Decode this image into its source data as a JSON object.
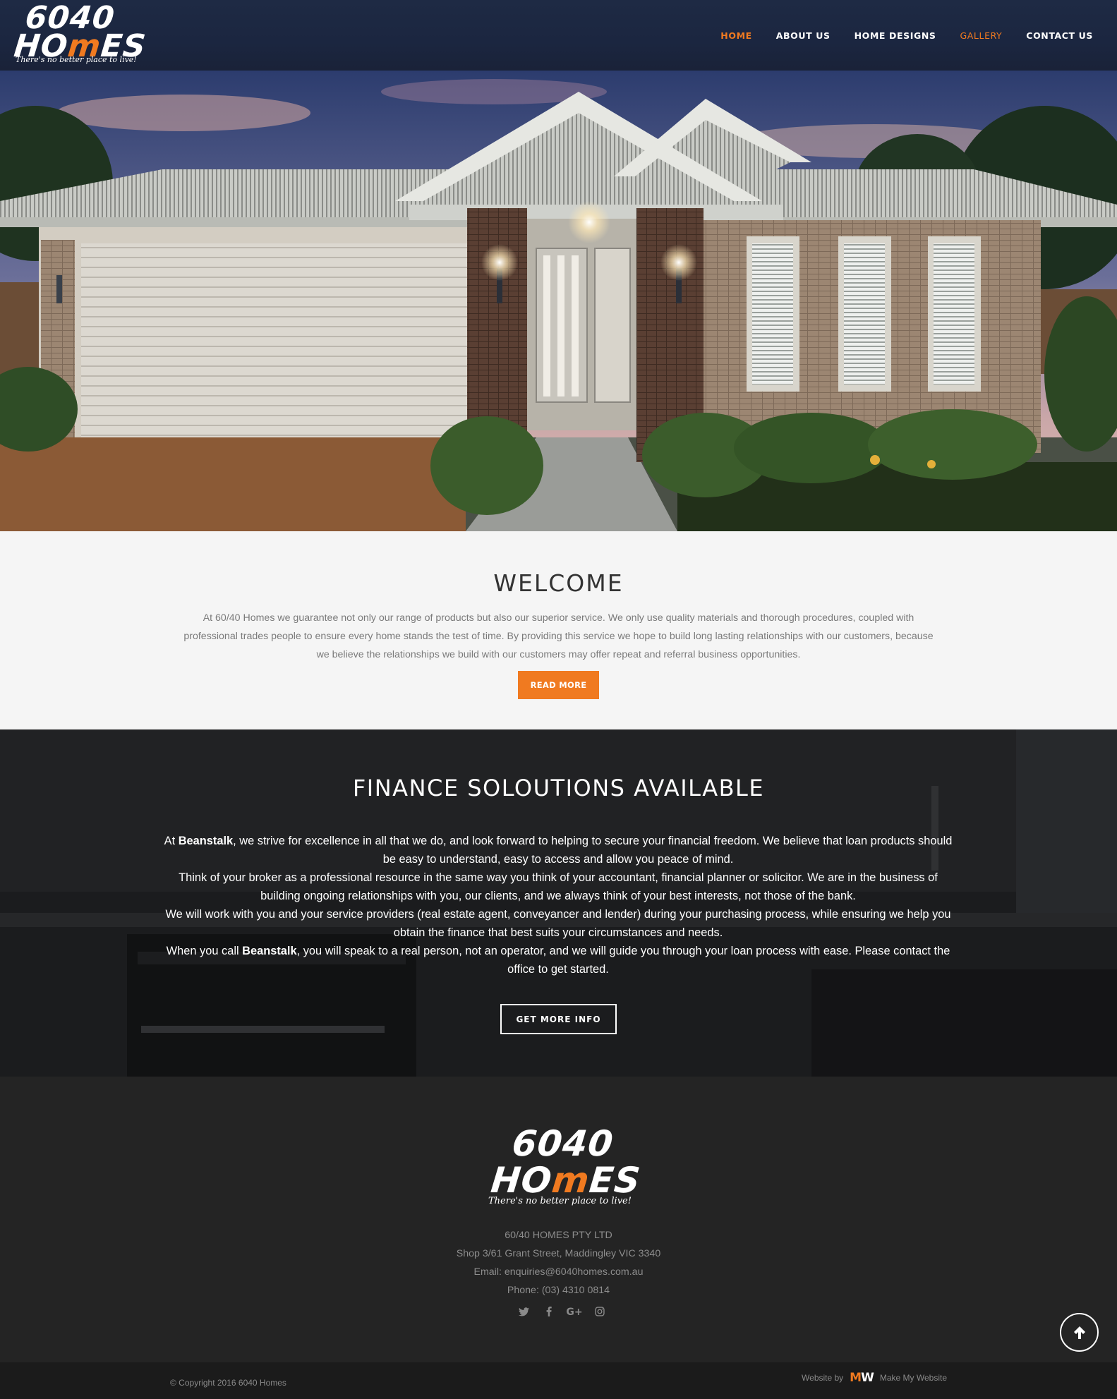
{
  "brand": {
    "logo_line1": "6040",
    "logo_line2_a": "HO",
    "logo_line2_m": "m",
    "logo_line2_b": "ES",
    "tagline": "There's no better place to live!",
    "accent_color": "#f07a20"
  },
  "nav": {
    "items": [
      {
        "label": "HOME",
        "active": true
      },
      {
        "label": "ABOUT US",
        "active": false
      },
      {
        "label": "HOME DESIGNS",
        "active": false
      },
      {
        "label": "GALLERY",
        "active": false
      },
      {
        "label": "CONTACT US",
        "active": false
      }
    ]
  },
  "welcome": {
    "title": "WELCOME",
    "text": "At 60/40 Homes we guarantee not only our range of products but also our superior service. We only use quality materials and thorough procedures, coupled with professional trades people to ensure every home stands the test of time. By providing this service we hope to build long lasting relationships with our customers, because we believe the relationships we build with our customers may offer repeat and referral business opportunities.",
    "button": "READ MORE"
  },
  "finance": {
    "title": "FINANCE SOLOUTIONS AVAILABLE",
    "p1_a": "At ",
    "p1_bold": "Beanstalk",
    "p1_b": ", we strive for excellence in all that we do, and look forward to helping to secure your financial freedom. We believe that loan products should be easy to understand, easy to access and allow you peace of mind.",
    "p2": "Think of your broker as a professional resource in the same way you think of your accountant, financial planner or solicitor. We are in the business of building ongoing relationships with you, our clients, and we always think of your best interests, not those of the bank.",
    "p3": "We will work with you and your service providers (real estate agent, conveyancer and lender) during your purchasing process, while ensuring we help you obtain the finance that best suits your circumstances and needs.",
    "p4_a": "When you call ",
    "p4_bold": "Beanstalk",
    "p4_b": ", you will speak to a real person, not an operator, and we will guide you through your loan process with ease. Please contact the office to get started.",
    "button": "GET MORE INFO"
  },
  "footer": {
    "company": "60/40 HOMES PTY LTD",
    "address": "Shop 3/61 Grant Street, Maddingley VIC 3340",
    "email": "Email: enquiries@6040homes.com.au",
    "phone": "Phone: (03) 4310 0814",
    "social": [
      "twitter-icon",
      "facebook-icon",
      "google-plus-icon",
      "instagram-icon"
    ],
    "copyright": "© Copyright 2016 6040 Homes",
    "website_by": "Website by",
    "mmw_logo_a": "M",
    "mmw_logo_b": "W",
    "website_by_name": "Make My Website"
  }
}
